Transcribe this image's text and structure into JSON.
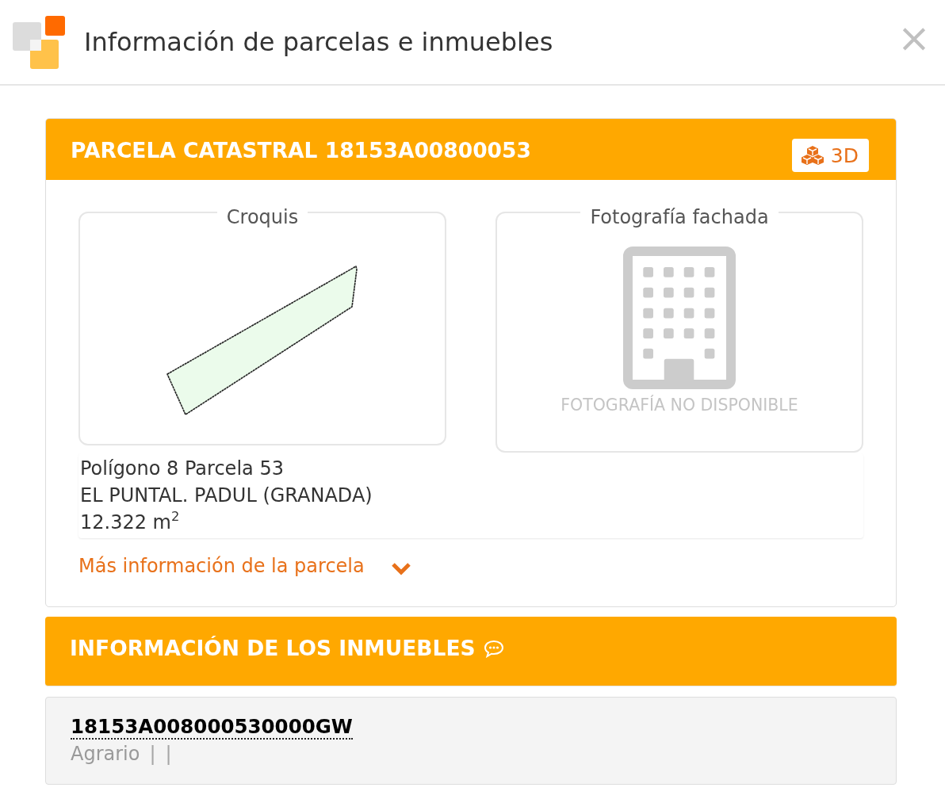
{
  "window": {
    "title": "Información de parcelas e inmuebles",
    "close": "×"
  },
  "parcel": {
    "title": "PARCELA CATASTRAL 18153A00800053",
    "button_3d": "3D",
    "sketch": {
      "legend": "Croquis"
    },
    "photo": {
      "legend": "Fotografía fachada",
      "message": "FOTOGRAFÍA NO DISPONIBLE"
    },
    "details": [
      "Polígono 8 Parcela 53",
      "EL PUNTAL. PADUL (GRANADA)",
      "12.322 m$^{2}$"
    ],
    "more_link": {
      "label": "Más información de la parcela",
      "expanded": false
    }
  },
  "properties": {
    "title": "INFORMACIÓN DE LOS INMUEBLES",
    "items": [
      {
        "reference": "18153A008000530000GW",
        "attributes": [
          {
            "kind": "value",
            "text": "Agrario"
          },
          {
            "kind": "separator",
            "text": "|"
          },
          {
            "kind": "separator",
            "text": "|"
          }
        ]
      }
    ]
  }
}
